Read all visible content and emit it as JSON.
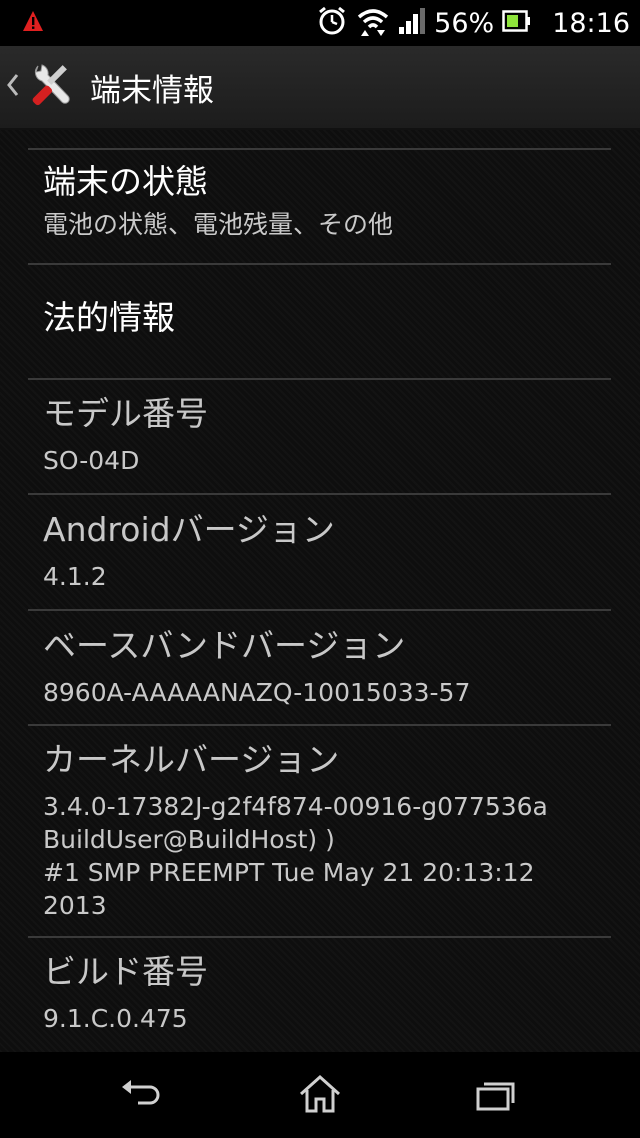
{
  "status_bar": {
    "battery_percent": "56%",
    "time": "18:16",
    "icons": [
      "warning-icon",
      "alarm-icon",
      "wifi-icon",
      "signal-icon",
      "battery-icon"
    ]
  },
  "action_bar": {
    "title": "端末情報",
    "icon": "tools-icon"
  },
  "items": [
    {
      "title": "端末の状態",
      "subtitle": "電池の状態、電池残量、その他"
    },
    {
      "title": "法的情報",
      "subtitle": ""
    },
    {
      "title": "モデル番号",
      "subtitle": "SO-04D"
    },
    {
      "title": "Androidバージョン",
      "subtitle": "4.1.2"
    },
    {
      "title": "ベースバンドバージョン",
      "subtitle": "8960A-AAAAANAZQ-10015033-57"
    },
    {
      "title": "カーネルバージョン",
      "subtitle": "3.4.0-17382J-g2f4f874-00916-g077536a\nBuildUser@BuildHost) )\n#1 SMP PREEMPT Tue May 21 20:13:12\n2013"
    },
    {
      "title": "ビルド番号",
      "subtitle": "9.1.C.0.475"
    }
  ],
  "nav_bar": {
    "icons": [
      "back-icon",
      "home-icon",
      "recent-apps-icon"
    ]
  },
  "colors": {
    "accent_warning": "#e02020",
    "background": "#0e0e0e",
    "divider": "#3a3a3a"
  }
}
